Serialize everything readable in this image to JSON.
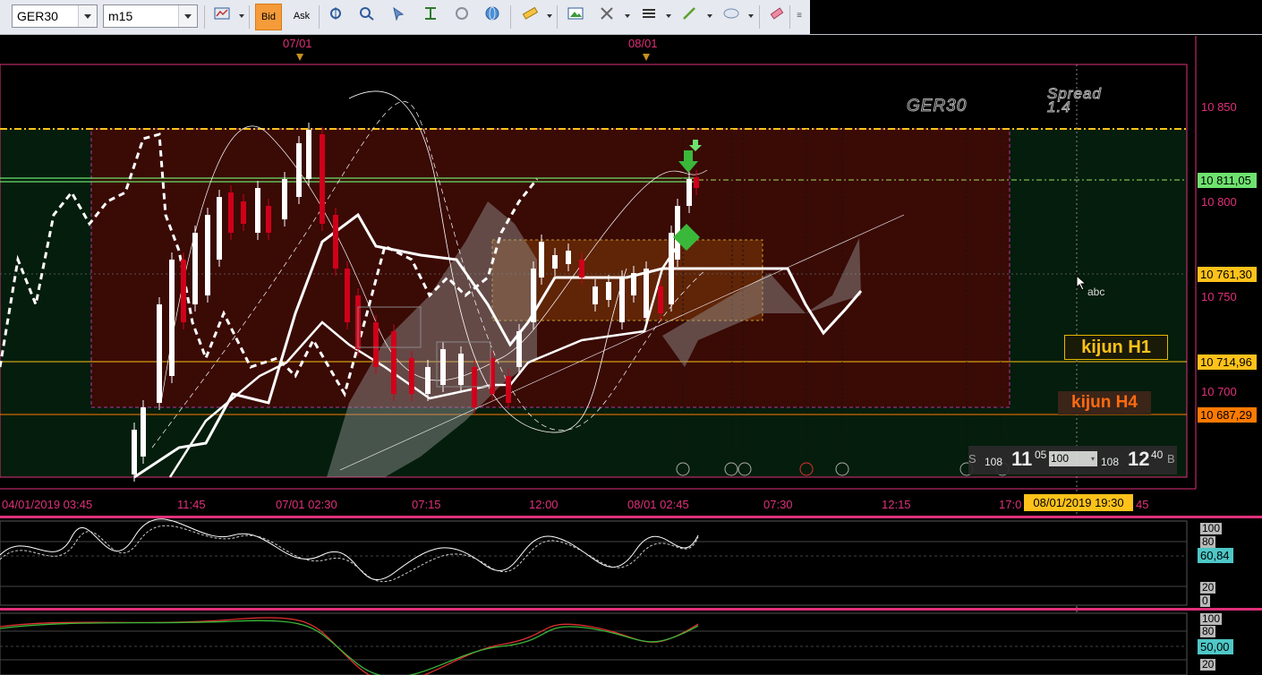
{
  "toolbar": {
    "symbol": "GER30",
    "timeframe": "m15",
    "bid_label": "Bid",
    "ask_label": "Ask",
    "icons": [
      "chart-type-icon",
      "crosshair-icon",
      "zoom-in-icon",
      "zoom-out-icon",
      "select-cursor-icon",
      "indicator-icon",
      "refresh-icon",
      "globe-icon",
      "ruler-icon",
      "image-icon",
      "tools-icon",
      "lines-icon",
      "pencil-line-icon",
      "ellipse-icon",
      "eraser-icon",
      "more-icon"
    ]
  },
  "chart": {
    "symbol_label": "GER30",
    "spread_label": "Spread",
    "spread_value": "1.4",
    "cursor_label": "abc",
    "price_axis": [
      "10 850",
      "10 800",
      "10 750",
      "10 700"
    ],
    "price_boxes": [
      {
        "label": "10 811,05",
        "color": "#6ee26e"
      },
      {
        "label": "10 761,30",
        "color": "#ffc21a"
      },
      {
        "label": "10 714,96",
        "color": "#ffc21a"
      },
      {
        "label": "10 687,29",
        "color": "#ff7a00"
      }
    ],
    "date_markers": [
      "07/01",
      "08/01"
    ],
    "time_axis": [
      "04/01/2019 03:45",
      "11:45",
      "07/01 02:30",
      "07:15",
      "12:00",
      "08/01 02:45",
      "07:30",
      "12:15",
      "17:0",
      "45"
    ],
    "time_cursor": "08/01/2019 19:30",
    "kijun_h1": "kijun H1",
    "kijun_h4": "kijun H4",
    "event_icons": [
      "event-icon",
      "event-icon",
      "event-icon",
      "event-icon",
      "event-icon"
    ],
    "panel": {
      "sell_label": "S",
      "sell_small": "108",
      "sell_big": "11",
      "sell_sup": "05",
      "qty": "100",
      "buy_small": "108",
      "buy_big": "12",
      "buy_sup": "40",
      "buy_label": "B"
    },
    "colors": {
      "bull": "#ffffff",
      "bear": "#d0001a",
      "zone": "#3a0a05",
      "kijun_h1": "#ffc21a",
      "kijun_h4": "#ff7a00",
      "axis": "#e0307a"
    }
  },
  "indicator1": {
    "levels": [
      "100",
      "80",
      "20",
      "0"
    ],
    "value": "60,84",
    "value_color": "#4fc7c7"
  },
  "indicator2": {
    "levels": [
      "100",
      "80",
      "20"
    ],
    "value": "50,00",
    "value_color": "#4fc7c7"
  }
}
